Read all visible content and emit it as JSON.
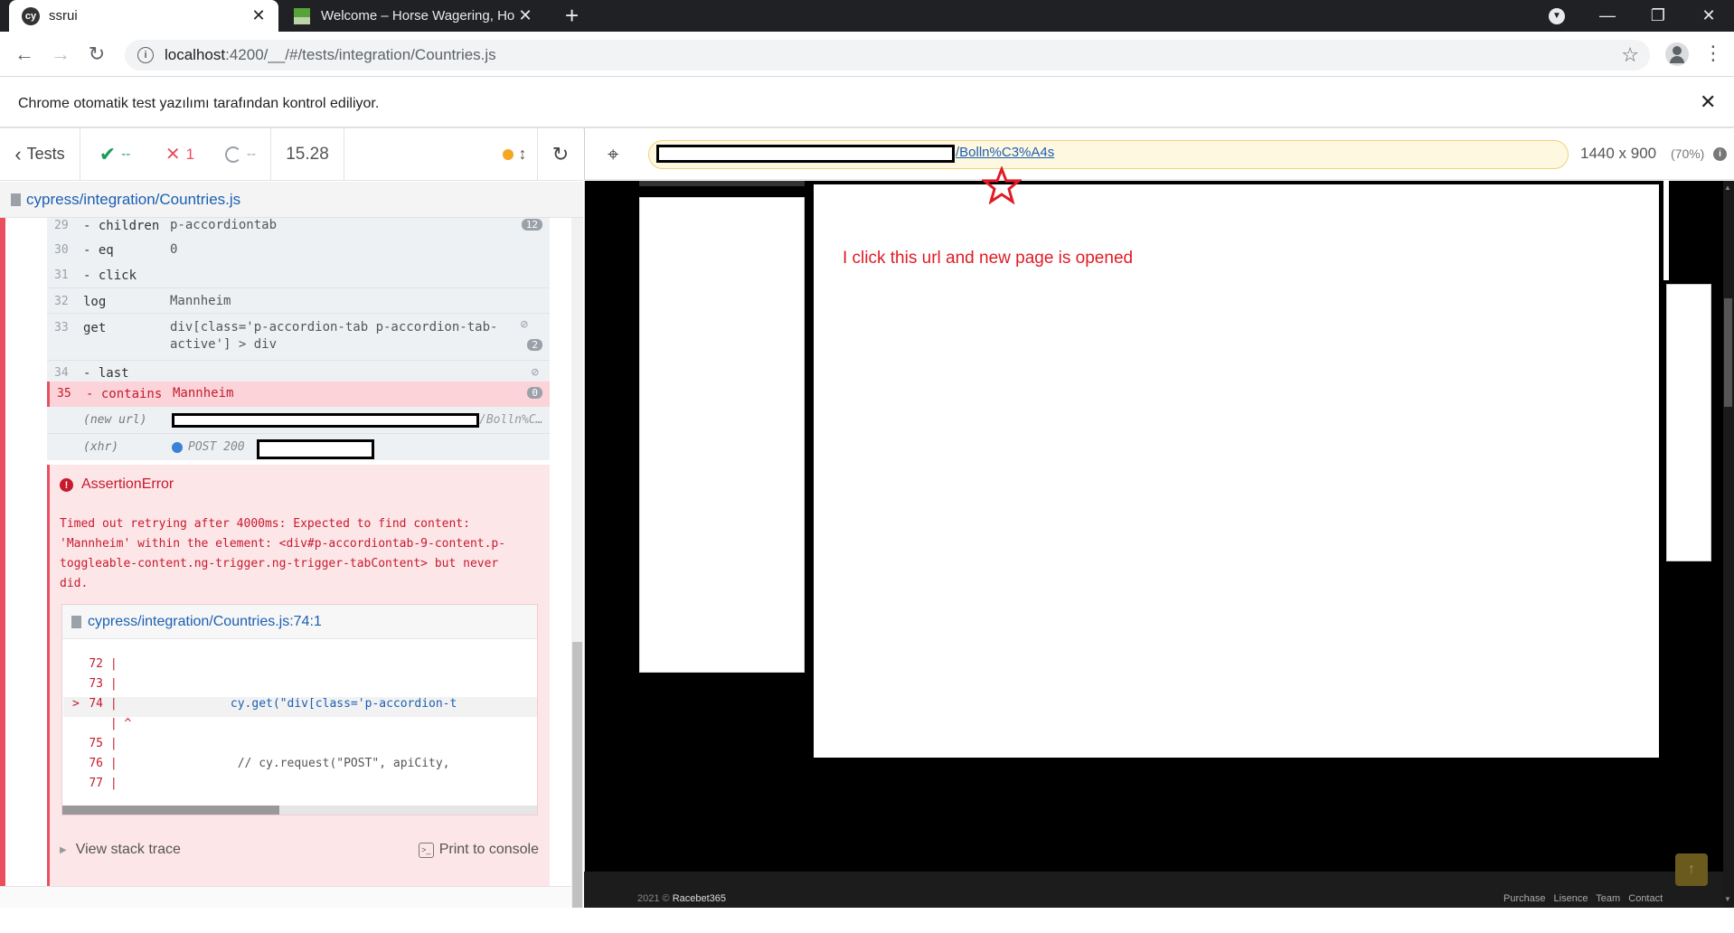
{
  "browser": {
    "tabs": [
      {
        "title": "ssrui",
        "favicon": "cypress-icon",
        "active": true
      },
      {
        "title": "Welcome – Horse Wagering, Hor",
        "favicon": "horse-site-icon",
        "active": false
      }
    ],
    "url_host": "localhost",
    "url_path": ":4200/__/#/tests/integration/Countries.js",
    "infobar_text": "Chrome otomatik test yazılımı tarafından kontrol ediliyor."
  },
  "reporter": {
    "tests_label": "Tests",
    "passed": "--",
    "failed": "1",
    "pending": "--",
    "duration": "15.28",
    "spec_path": "cypress/integration/Countries.js",
    "commands": [
      {
        "num": "29",
        "name": "- children",
        "message": "p-accordiontab",
        "badge": "12"
      },
      {
        "num": "30",
        "name": "- eq",
        "message": "0",
        "badge": ""
      },
      {
        "num": "31",
        "name": "- click",
        "message": "",
        "badge": ""
      },
      {
        "num": "32",
        "name": "log",
        "message": "Mannheim",
        "badge": ""
      },
      {
        "num": "33",
        "name": "get",
        "message": "div[class='p-accordion-tab p-accordion-tab-",
        "message2": "active'] > div",
        "badge": "2"
      },
      {
        "num": "34",
        "name": "- last",
        "message": "",
        "badge": ""
      },
      {
        "num": "35",
        "name": "- contains",
        "message": "Mannheim",
        "badge": "0"
      }
    ],
    "new_url_label": "(new url)",
    "new_url_suffix": "/Bolln%C…",
    "xhr_label": "(xhr)",
    "xhr_status": "POST 200",
    "error": {
      "title": "AssertionError",
      "message": "Timed out retrying after 4000ms: Expected to find content:\n'Mannheim' within the element: <div#p-accordiontab-9-content.p-\ntoggleable-content.ng-trigger.ng-trigger-tabContent> but never\ndid.",
      "file_link": "cypress/integration/Countries.js:74:1",
      "code_lines": [
        {
          "ln": "72",
          "marker": "",
          "code": ""
        },
        {
          "ln": "73",
          "marker": "",
          "code": ""
        },
        {
          "ln": "74",
          "marker": ">",
          "code": "                cy.get(\"div[class='p-accordion-t"
        },
        {
          "ln": "",
          "marker": "",
          "code": " ^"
        },
        {
          "ln": "75",
          "marker": "",
          "code": ""
        },
        {
          "ln": "76",
          "marker": "",
          "code": "                 // cy.request(\"POST\", apiCity,"
        },
        {
          "ln": "77",
          "marker": "",
          "code": ""
        }
      ],
      "view_stack_trace": "View stack trace",
      "print_to_console": "Print to console"
    }
  },
  "aut": {
    "url_suffix": "/Bolln%C3%A4s",
    "viewport_size": "1440 x 900",
    "viewport_zoom": "(70%)",
    "annotation": "I click this url and new page is opened",
    "footer_year": "2021 ©",
    "footer_brand": "Racebet365",
    "footer_links": "Purchase Lisence  Team  Contact"
  },
  "colors": {
    "cypress_fail": "#e94f5f",
    "error_text": "#c61a2e",
    "annotation_red": "#e01b24"
  }
}
